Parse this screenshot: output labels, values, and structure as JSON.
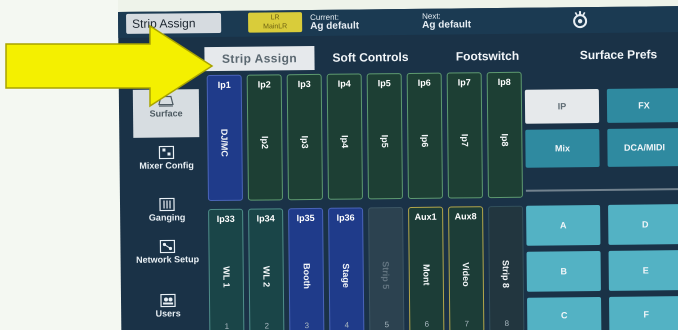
{
  "topbar": {
    "scene_name": "Strip Assign",
    "lr_badge_line1": "LR",
    "lr_badge_line2": "MainLR",
    "current_label": "Current:",
    "current_value": "Ag default",
    "next_label": "Next:",
    "next_value": "Ag default",
    "settings_icon": "gear-icon"
  },
  "tabs": [
    {
      "label": "Strip Assign",
      "active": true
    },
    {
      "label": "Soft Controls",
      "active": false
    },
    {
      "label": "Footswitch",
      "active": false
    },
    {
      "label": "Surface Prefs",
      "active": false
    }
  ],
  "leftnav": [
    {
      "label": "Surface",
      "icon": "surface-icon",
      "active": true
    },
    {
      "label": "Mixer Config",
      "icon": "mixer-icon",
      "active": false
    },
    {
      "label": "Ganging",
      "icon": "ganging-icon",
      "active": false
    },
    {
      "label": "Network Setup",
      "icon": "network-icon",
      "active": false
    },
    {
      "label": "Users",
      "icon": "users-icon",
      "active": false
    }
  ],
  "strips_row1": [
    {
      "port": "Ip1",
      "name": "DJ/MC",
      "num": "",
      "style": "blue"
    },
    {
      "port": "Ip2",
      "name": "Ip2",
      "num": "",
      "style": "green"
    },
    {
      "port": "Ip3",
      "name": "Ip3",
      "num": "",
      "style": "green"
    },
    {
      "port": "Ip4",
      "name": "Ip4",
      "num": "",
      "style": "green"
    },
    {
      "port": "Ip5",
      "name": "Ip5",
      "num": "",
      "style": "green"
    },
    {
      "port": "Ip6",
      "name": "Ip6",
      "num": "",
      "style": "green"
    },
    {
      "port": "Ip7",
      "name": "Ip7",
      "num": "",
      "style": "green"
    },
    {
      "port": "Ip8",
      "name": "Ip8",
      "num": "",
      "style": "green"
    }
  ],
  "strips_row2": [
    {
      "port": "Ip33",
      "name": "WL 1",
      "num": "1",
      "style": "teal"
    },
    {
      "port": "Ip34",
      "name": "WL 2",
      "num": "2",
      "style": "teal"
    },
    {
      "port": "Ip35",
      "name": "Booth",
      "num": "3",
      "style": "blue"
    },
    {
      "port": "Ip36",
      "name": "Stage",
      "num": "4",
      "style": "blue"
    },
    {
      "port": "",
      "name": "Strip 5",
      "num": "5",
      "style": "empty"
    },
    {
      "port": "Aux1",
      "name": "Mont",
      "num": "6",
      "style": "gold"
    },
    {
      "port": "Aux8",
      "name": "Video",
      "num": "7",
      "style": "gold"
    },
    {
      "port": "",
      "name": "Strip 8",
      "num": "8",
      "style": "dark"
    }
  ],
  "layer_buttons": {
    "ip": "IP",
    "fx": "FX",
    "mix": "Mix",
    "dca": "DCA/MIDI"
  },
  "bank_buttons": {
    "a": "A",
    "b": "B",
    "c": "C",
    "d": "D",
    "e": "E",
    "f": "F"
  },
  "colors": {
    "annotation_arrow": "#f4f000",
    "panel_bg": "#1a3247",
    "accent_teal": "#2f8aa0"
  }
}
